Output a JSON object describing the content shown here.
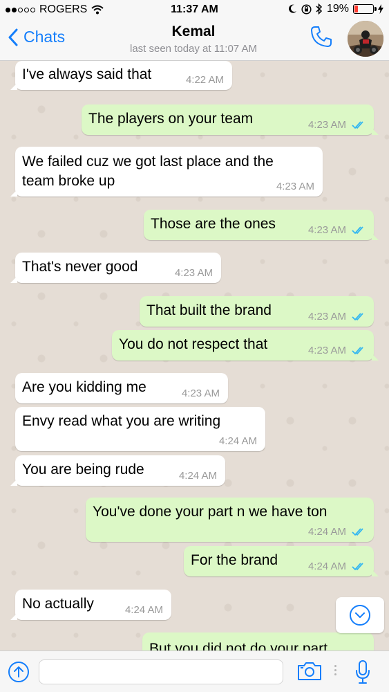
{
  "status_bar": {
    "carrier": "ROGERS",
    "time": "11:37 AM",
    "battery": "19%",
    "battery_level": 0.19,
    "signal_bars_filled": 2,
    "signal_bars_total": 5
  },
  "nav": {
    "back_label": "Chats",
    "contact_name": "Kemal",
    "contact_status": "last seen today at 11:07 AM"
  },
  "messages": [
    {
      "text": "I've always said that",
      "time": "4:22 AM",
      "dir": "in"
    },
    {
      "text": "The players on your team",
      "time": "4:23 AM",
      "dir": "out",
      "read": true
    },
    {
      "text": "We failed cuz we got last place and the",
      "text2": "team broke up",
      "time": "4:23 AM",
      "dir": "in"
    },
    {
      "text": "Those are the ones",
      "time": "4:23 AM",
      "dir": "out",
      "read": true
    },
    {
      "text": "That's never good",
      "time": "4:23 AM",
      "dir": "in"
    },
    {
      "text": "That built the brand",
      "time": "4:23 AM",
      "dir": "out",
      "read": true
    },
    {
      "text": "You do not respect that",
      "time": "4:23 AM",
      "dir": "out",
      "read": true
    },
    {
      "text": "Are you kidding me",
      "time": "4:23 AM",
      "dir": "in"
    },
    {
      "text": "Envy read what you are writing",
      "time": "4:24 AM",
      "dir": "in"
    },
    {
      "text": "You are being rude",
      "time": "4:24 AM",
      "dir": "in"
    },
    {
      "text": "You've done your part n we have ton",
      "time": "4:24 AM",
      "dir": "out",
      "read": true
    },
    {
      "text": "For the brand",
      "time": "4:24 AM",
      "dir": "out",
      "read": true
    },
    {
      "text": "No actually",
      "time": "4:24 AM",
      "dir": "in"
    },
    {
      "text": "But you did not do your part",
      "time": "",
      "dir": "out"
    }
  ],
  "input": {
    "value": "",
    "placeholder": ""
  },
  "icons": {
    "back": "chevron-left-icon",
    "call": "phone-icon",
    "scroll": "chevron-down-icon",
    "attach": "arrow-up-icon",
    "camera": "camera-icon",
    "mic": "microphone-icon",
    "read_receipt": "double-check-icon"
  },
  "colors": {
    "accent": "#147efb",
    "outgoing_bubble": "#dcf8c6",
    "incoming_bubble": "#ffffff",
    "read_ticks": "#34b7f1",
    "battery_low": "#ff3b30"
  }
}
